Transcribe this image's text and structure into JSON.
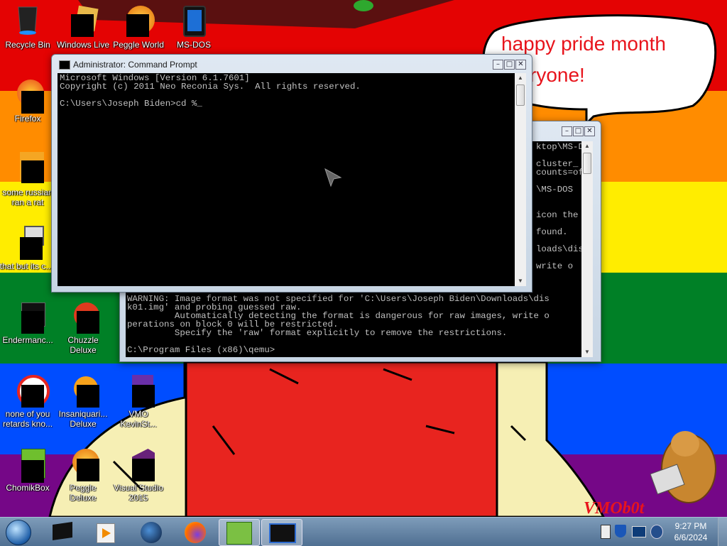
{
  "desktop": {
    "icons": [
      {
        "label": "Recycle Bin",
        "icon": "recycle-bin-icon"
      },
      {
        "label": "Windows Live",
        "icon": "windows-live-icon"
      },
      {
        "label": "Peggle World",
        "icon": "peggle-world-icon"
      },
      {
        "label": "MS-DOS",
        "icon": "ms-dos-icon"
      },
      {
        "label": "Firefox",
        "icon": "firefox-icon"
      },
      {
        "label": "some russian ran a rat",
        "icon": "app-icon"
      },
      {
        "label": "that but its c...",
        "icon": "shortcut-icon"
      },
      {
        "label": "Endermanc...",
        "icon": "app-icon"
      },
      {
        "label": "Chuzzle Deluxe",
        "icon": "chuzzle-icon"
      },
      {
        "label": "none of you retards kno...",
        "icon": "app-icon"
      },
      {
        "label": "Insaniquari... Deluxe",
        "icon": "insaniquarium-icon"
      },
      {
        "label": "VMO KevinSt...",
        "icon": "vm-icon"
      },
      {
        "label": "ChomikBox",
        "icon": "chomikbox-icon"
      },
      {
        "label": "Peggle Deluxe",
        "icon": "peggle-icon"
      },
      {
        "label": "Visual Studio 2015",
        "icon": "visual-studio-icon"
      }
    ],
    "speech_bubble": [
      "happy pride month",
      "ryone!"
    ],
    "watermark": "VMOb0t"
  },
  "cmd_window": {
    "title": "Administrator: Command Prompt",
    "lines": [
      "Microsoft Windows [Version 6.1.7601]",
      "Copyright (c) 2011 Neo Reconia Sys.  All rights reserved.",
      "",
      "C:\\Users\\Joseph Biden>cd %_"
    ]
  },
  "back_console": {
    "side_lines": [
      "ktop\\MS-D",
      "",
      "cluster_",
      "counts=of",
      "",
      "\\MS-DOS",
      "",
      "",
      "icon the",
      "",
      "found.",
      "",
      "loads\\dis",
      "",
      "write o"
    ],
    "bottom_lines": [
      "WARNING: Image format was not specified for 'C:\\Users\\Joseph Biden\\Downloads\\dis",
      "k01.img' and probing guessed raw.",
      "         Automatically detecting the format is dangerous for raw images, write o",
      "perations on block 0 will be restricted.",
      "         Specify the 'raw' format explicitly to remove the restrictions.",
      "",
      "C:\\Program Files (x86)\\qemu>"
    ]
  },
  "taskbar": {
    "buttons": [
      "start-orb",
      "cmd-icon",
      "media-player-icon",
      "globe-icon",
      "firefox-icon",
      "chomikbox-icon",
      "console-icon"
    ],
    "time": "9:27 PM",
    "date": "6/6/2024"
  },
  "colors": {
    "red": "#e40303",
    "orange": "#ff8c00",
    "yellow": "#ffed00",
    "green": "#008026",
    "blue": "#004dff",
    "purple": "#750787"
  }
}
